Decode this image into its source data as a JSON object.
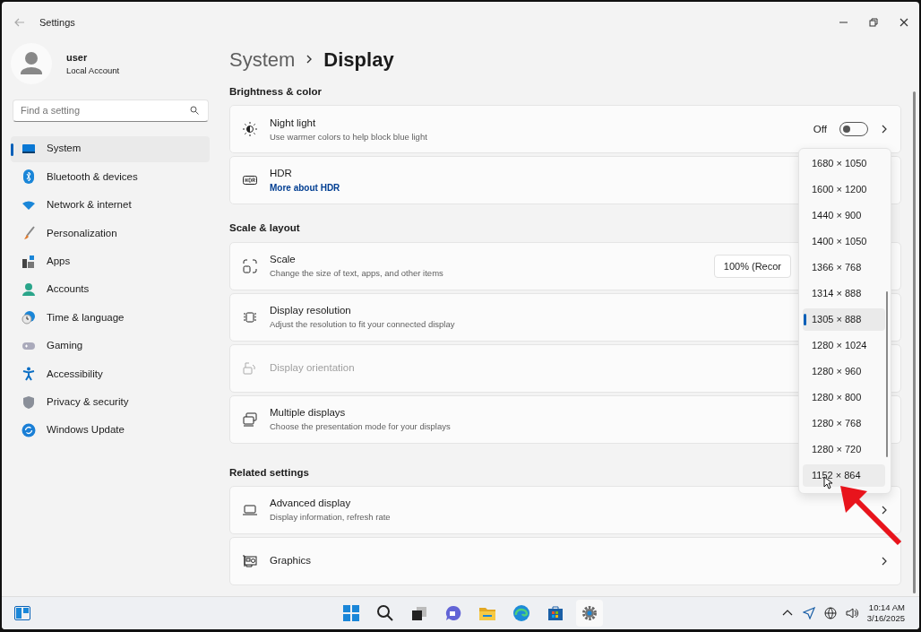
{
  "window": {
    "title": "Settings"
  },
  "user": {
    "name": "user",
    "account": "Local Account"
  },
  "search": {
    "placeholder": "Find a setting"
  },
  "sidebar": {
    "items": [
      {
        "label": "System",
        "selected": true
      },
      {
        "label": "Bluetooth & devices",
        "selected": false
      },
      {
        "label": "Network & internet",
        "selected": false
      },
      {
        "label": "Personalization",
        "selected": false
      },
      {
        "label": "Apps",
        "selected": false
      },
      {
        "label": "Accounts",
        "selected": false
      },
      {
        "label": "Time & language",
        "selected": false
      },
      {
        "label": "Gaming",
        "selected": false
      },
      {
        "label": "Accessibility",
        "selected": false
      },
      {
        "label": "Privacy & security",
        "selected": false
      },
      {
        "label": "Windows Update",
        "selected": false
      }
    ]
  },
  "breadcrumb": [
    "System",
    "Display"
  ],
  "sections": [
    {
      "title": "Brightness & color",
      "rows": [
        {
          "kind": "toggle",
          "title": "Night light",
          "description": "Use warmer colors to help block blue light",
          "state_label": "Off",
          "on": false,
          "chevron": true,
          "disabled": false
        },
        {
          "kind": "link",
          "title": "HDR",
          "link": "More about HDR",
          "chevron": false,
          "disabled": false
        }
      ]
    },
    {
      "title": "Scale & layout",
      "rows": [
        {
          "kind": "select",
          "title": "Scale",
          "description": "Change the size of text, apps, and other items",
          "value": "100% (Recor",
          "chevron": false,
          "disabled": false
        },
        {
          "kind": "plain",
          "title": "Display resolution",
          "description": "Adjust the resolution to fit your connected display",
          "chevron": false,
          "disabled": false
        },
        {
          "kind": "plain",
          "title": "Display orientation",
          "chevron": false,
          "disabled": true
        },
        {
          "kind": "plain",
          "title": "Multiple displays",
          "description": "Choose the presentation mode for your displays",
          "chevron": false,
          "disabled": false
        }
      ]
    },
    {
      "title": "Related settings",
      "rows": [
        {
          "kind": "plain",
          "title": "Advanced display",
          "description": "Display information, refresh rate",
          "chevron": true,
          "disabled": false
        },
        {
          "kind": "plain",
          "title": "Graphics",
          "chevron": true,
          "disabled": false
        }
      ]
    }
  ],
  "resolution_menu": {
    "options": [
      {
        "label": "1680 × 1050",
        "selected": false,
        "hovered": false
      },
      {
        "label": "1600 × 1200",
        "selected": false,
        "hovered": false
      },
      {
        "label": "1440 × 900",
        "selected": false,
        "hovered": false
      },
      {
        "label": "1400 × 1050",
        "selected": false,
        "hovered": false
      },
      {
        "label": "1366 × 768",
        "selected": false,
        "hovered": false
      },
      {
        "label": "1314 × 888",
        "selected": false,
        "hovered": false
      },
      {
        "label": "1305 × 888",
        "selected": true,
        "hovered": false
      },
      {
        "label": "1280 × 1024",
        "selected": false,
        "hovered": false
      },
      {
        "label": "1280 × 960",
        "selected": false,
        "hovered": false
      },
      {
        "label": "1280 × 800",
        "selected": false,
        "hovered": false
      },
      {
        "label": "1280 × 768",
        "selected": false,
        "hovered": false
      },
      {
        "label": "1280 × 720",
        "selected": false,
        "hovered": false
      },
      {
        "label": "1152 × 864",
        "selected": false,
        "hovered": true
      }
    ]
  },
  "taskbar": {
    "time": "10:14 AM",
    "date": "3/16/2025"
  }
}
